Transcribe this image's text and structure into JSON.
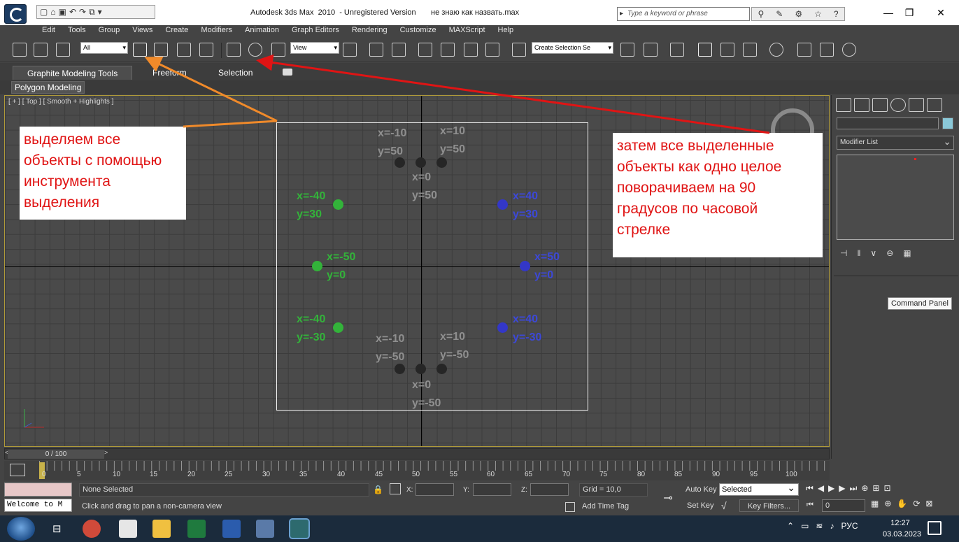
{
  "window": {
    "title": "Autodesk 3ds Max  2010  - Unregistered Version       не знаю как назвать.max",
    "search_placeholder": "Type a keyword or phrase",
    "minimize": "—",
    "maximize": "❐",
    "close": "✕"
  },
  "menu": [
    "Edit",
    "Tools",
    "Group",
    "Views",
    "Create",
    "Modifiers",
    "Animation",
    "Graph Editors",
    "Rendering",
    "Customize",
    "MAXScript",
    "Help"
  ],
  "toolbar": {
    "selection_filter": "All",
    "ref_coord": "View",
    "named_selection": "Create Selection Se"
  },
  "ribbon": {
    "tabs": [
      "Graphite Modeling Tools",
      "Freeform",
      "Selection"
    ],
    "subtab": "Polygon Modeling"
  },
  "viewport": {
    "label": "[ + ] [ Top ] [ Smooth + Highlights ]",
    "coords": [
      {
        "x": "x=-10",
        "y": "y=50",
        "color": "gray"
      },
      {
        "x": "x=10",
        "y": "y=50",
        "color": "gray"
      },
      {
        "x": "x=0",
        "y": "y=50",
        "color": "gray"
      },
      {
        "x": "x=-40",
        "y": "y=30",
        "color": "green"
      },
      {
        "x": "x=40",
        "y": "y=30",
        "color": "blue"
      },
      {
        "x": "x=-50",
        "y": "y=0",
        "color": "green"
      },
      {
        "x": "x=50",
        "y": "y=0",
        "color": "blue"
      },
      {
        "x": "x=-40",
        "y": "y=-30",
        "color": "green"
      },
      {
        "x": "x=40",
        "y": "y=-30",
        "color": "blue"
      },
      {
        "x": "x=-10",
        "y": "y=-50",
        "color": "gray"
      },
      {
        "x": "x=10",
        "y": "y=-50",
        "color": "gray"
      },
      {
        "x": "x=0",
        "y": "y=-50",
        "color": "gray"
      }
    ],
    "colors": {
      "green": "#33b33a",
      "blue": "#3c48d8",
      "gray": "#8f8f8f",
      "annotation": "#e01414"
    }
  },
  "notes": {
    "left": "выделяем все\nобъекты с помощью\nинструмента\nвыделения",
    "right": "затем все выделенные\nобъекты как одно целое\nповорачиваем на 90\nградусов по часовой\nстрелке"
  },
  "command_panel": {
    "modifier_list": "Modifier List",
    "tooltip": "Command Panel"
  },
  "timeline": {
    "position": "0 / 100",
    "ticks": [
      "0",
      "5",
      "10",
      "15",
      "20",
      "25",
      "30",
      "35",
      "40",
      "45",
      "50",
      "55",
      "60",
      "65",
      "70",
      "75",
      "80",
      "85",
      "90",
      "95",
      "100"
    ]
  },
  "status": {
    "maxscript": "Welcome to M",
    "selected": "None Selected",
    "prompt": "Click and drag to pan a non-camera view",
    "x_label": "X:",
    "y_label": "Y:",
    "z_label": "Z:",
    "grid": "Grid = 10,0",
    "add_time_tag": "Add Time Tag",
    "auto_key": "Auto Key",
    "key_mode": "Selected",
    "set_key": "Set Key",
    "key_filters": "Key Filters...",
    "frame": "0"
  },
  "taskbar": {
    "language": "РУС",
    "time": "12:27",
    "date": "03.03.2023"
  }
}
